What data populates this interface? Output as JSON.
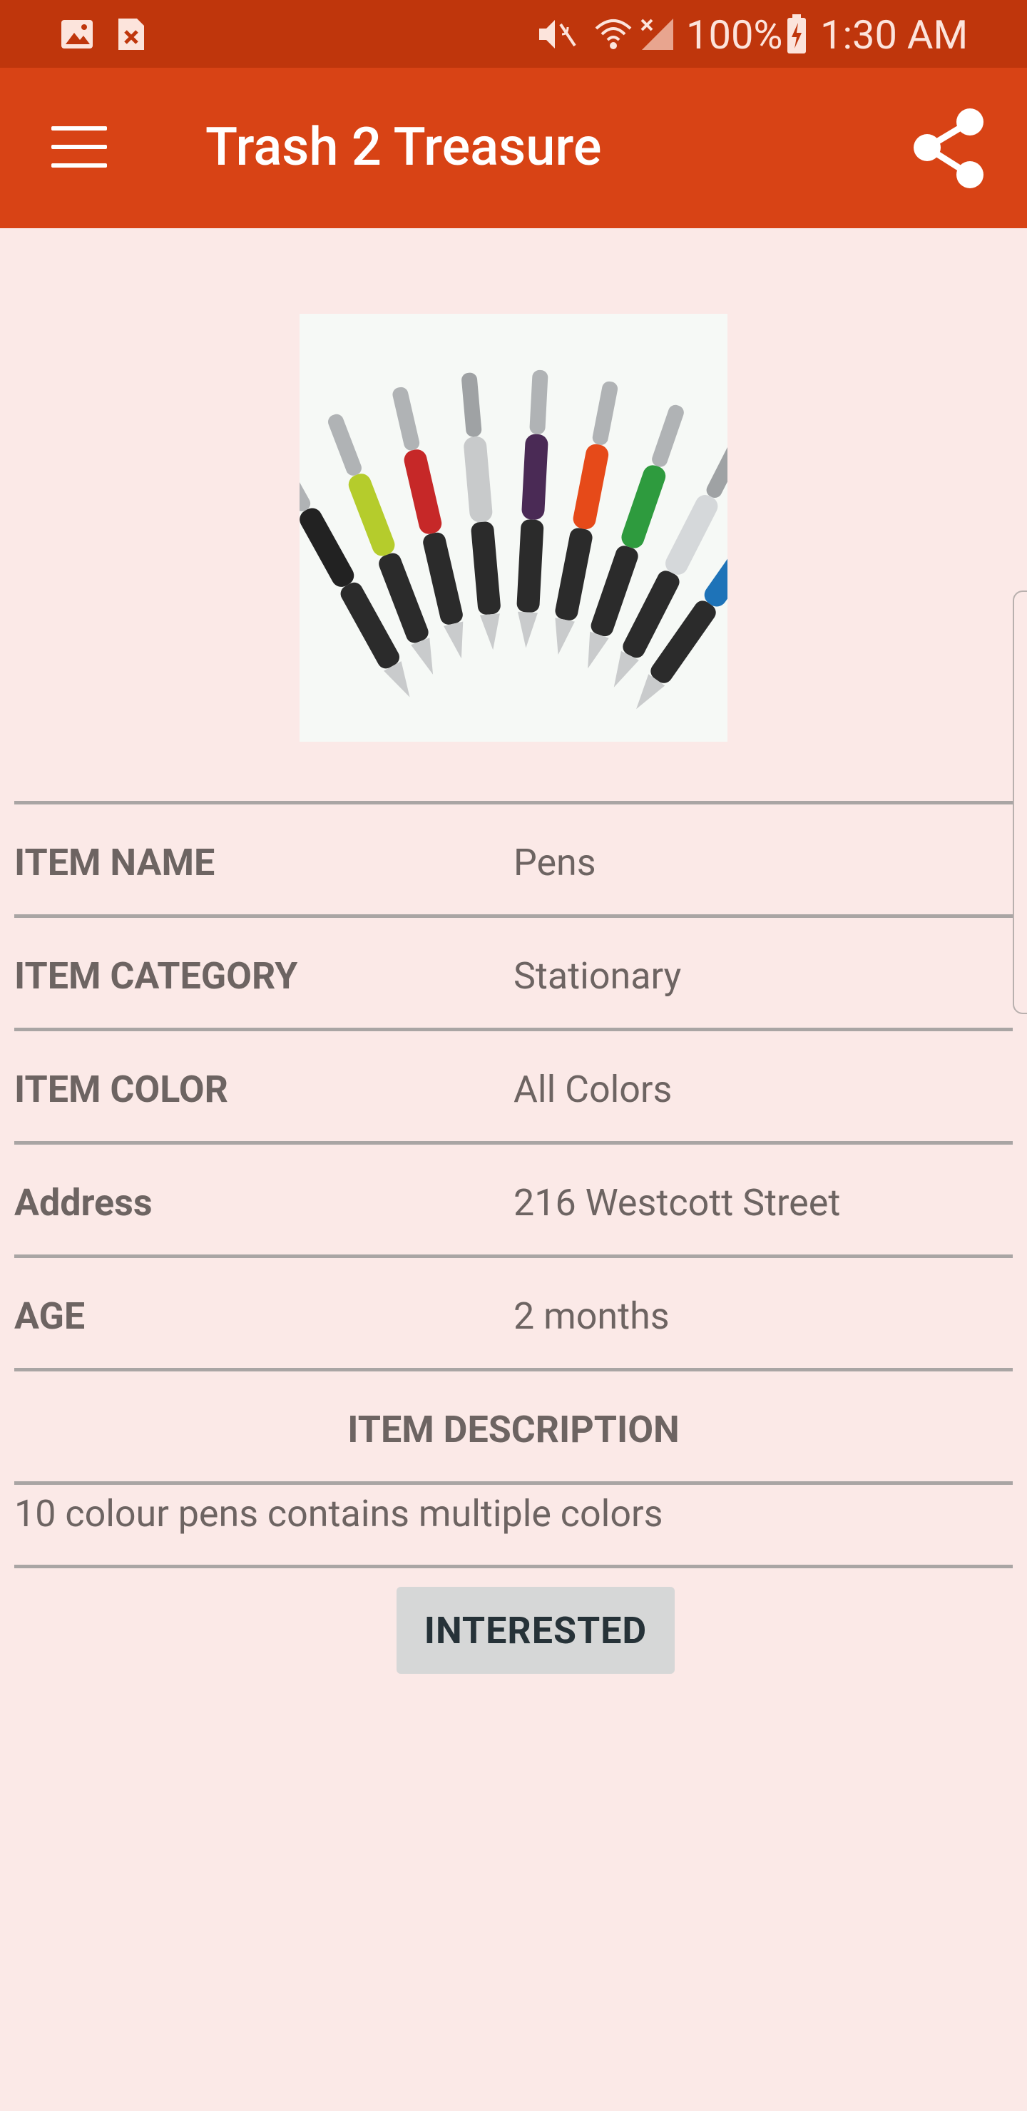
{
  "status_bar": {
    "battery": "100%",
    "time": "1:30 AM",
    "icons": [
      "image-icon",
      "close-box-icon",
      "mute-icon",
      "wifi-icon",
      "signal-icon",
      "battery-charging-icon"
    ]
  },
  "app_bar": {
    "title": "Trash 2 Treasure",
    "menu_icon": "menu-icon",
    "share_icon": "share-icon"
  },
  "item": {
    "image_icon": "pens-image",
    "details": [
      {
        "label": "ITEM NAME",
        "value": "Pens"
      },
      {
        "label": "ITEM CATEGORY",
        "value": "Stationary"
      },
      {
        "label": "ITEM COLOR",
        "value": "All Colors"
      },
      {
        "label": "Address",
        "value": "216 Westcott Street"
      },
      {
        "label": "AGE",
        "value": "2 months"
      }
    ],
    "description_title": "ITEM DESCRIPTION",
    "description": "10 colour pens contains multiple colors",
    "interested_label": "INTERESTED"
  },
  "colors": {
    "status_bar": "#bf360c",
    "app_bar": "#d84315",
    "background": "#fbe9e7",
    "text": "#6d6462"
  }
}
